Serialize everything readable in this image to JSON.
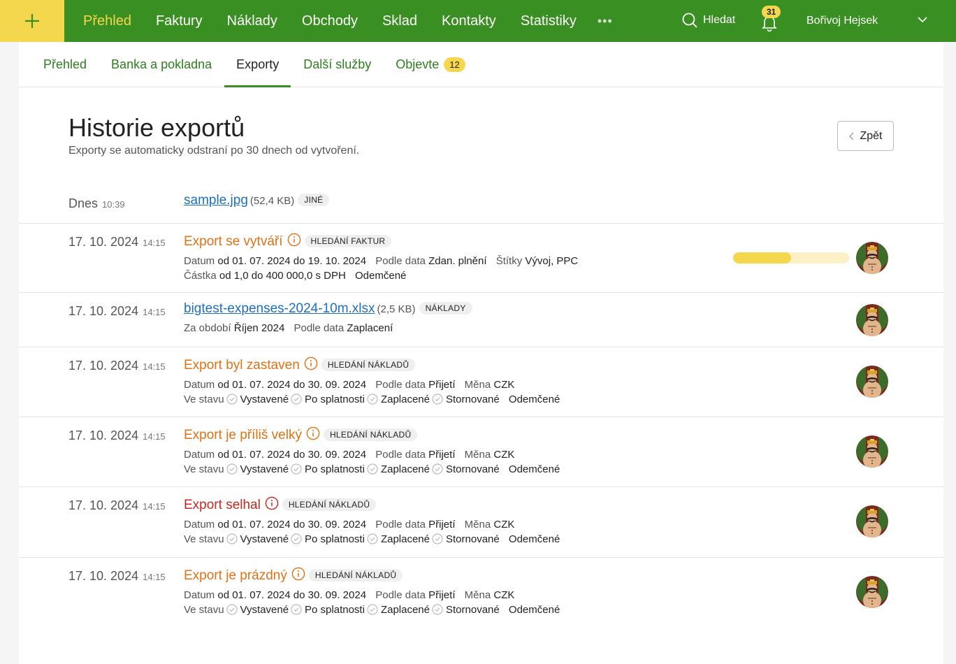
{
  "topnav": {
    "plus_label": "+",
    "items": [
      {
        "label": "Přehled",
        "active": true
      },
      {
        "label": "Faktury"
      },
      {
        "label": "Náklady"
      },
      {
        "label": "Obchody"
      },
      {
        "label": "Sklad"
      },
      {
        "label": "Kontakty"
      },
      {
        "label": "Statistiky"
      }
    ],
    "more_label": "•••",
    "search_label": "Hledat",
    "notifications_count": "31",
    "user_name": "Bořivoj Hejsek"
  },
  "subnav": {
    "tabs": [
      {
        "label": "Přehled"
      },
      {
        "label": "Banka a pokladna"
      },
      {
        "label": "Exporty",
        "active": true
      },
      {
        "label": "Další služby"
      },
      {
        "label": "Objevte",
        "badge": "12"
      }
    ]
  },
  "page": {
    "title": "Historie exportů",
    "subtitle": "Exporty se automaticky odstraní po 30 dnech od vytvoření.",
    "back_label": "Zpět"
  },
  "labels": {
    "datum": "Datum",
    "podle_data": "Podle data",
    "stitky": "Štítky",
    "castka": "Částka",
    "za_obdobi": "Za období",
    "mena": "Měna",
    "ve_stavu": "Ve stavu",
    "vystavene": "Vystavené",
    "po_splatnosti": "Po splatnosti",
    "zaplacene": "Zaplacené",
    "stornovane": "Stornované",
    "odemcene": "Odemčené"
  },
  "exports": [
    {
      "date": "Dnes",
      "time": "10:39",
      "title": "sample.jpg",
      "size": "(52,4 KB)",
      "tag": "JINÉ"
    },
    {
      "date": "17. 10. 2024",
      "time": "14:15",
      "title": "Export se vytváří",
      "tag": "HLEDÁNÍ FAKTUR",
      "datum_value": "od 01. 07. 2024 do 19. 10. 2024",
      "podle_data_value": "Zdan. plnění",
      "stitky_value": "Vývoj, PPC",
      "castka_value": "od 1,0 do 400 000,0 s DPH",
      "progress": 0.5
    },
    {
      "date": "17. 10. 2024",
      "time": "14:15",
      "title": "bigtest-expenses-2024-10m.xlsx",
      "size": "(2,5 KB)",
      "tag": "NÁKLADY",
      "obdobi_value": "Říjen 2024",
      "podle_data_value": "Zaplacení"
    },
    {
      "date": "17. 10. 2024",
      "time": "14:15",
      "title": "Export byl zastaven",
      "tag": "HLEDÁNÍ NÁKLADŮ",
      "datum_value": "od 01. 07. 2024 do 30. 09. 2024",
      "podle_data_value": "Přijetí",
      "mena_value": "CZK"
    },
    {
      "date": "17. 10. 2024",
      "time": "14:15",
      "title": "Export je příliš velký",
      "tag": "HLEDÁNÍ NÁKLADŮ",
      "datum_value": "od 01. 07. 2024 do 30. 09. 2024",
      "podle_data_value": "Přijetí",
      "mena_value": "CZK"
    },
    {
      "date": "17. 10. 2024",
      "time": "14:15",
      "title": "Export selhal",
      "tag": "HLEDÁNÍ NÁKLADŮ",
      "datum_value": "od 01. 07. 2024 do 30. 09. 2024",
      "podle_data_value": "Přijetí",
      "mena_value": "CZK"
    },
    {
      "date": "17. 10. 2024",
      "time": "14:15",
      "title": "Export je prázdný",
      "tag": "HLEDÁNÍ NÁKLADŮ",
      "datum_value": "od 01. 07. 2024 do 30. 09. 2024",
      "podle_data_value": "Přijetí",
      "mena_value": "CZK"
    }
  ],
  "colors": {
    "brand_green": "#3a8f22",
    "accent_yellow": "#f5d74e",
    "link_blue": "#1f6fc0",
    "warning_orange": "#e07214",
    "error_red": "#c6281f"
  },
  "icons": [
    "plus-icon",
    "search-icon",
    "bell-icon",
    "chevron-down-icon",
    "chevron-left-icon",
    "info-icon",
    "check-circle-icon",
    "avatar"
  ]
}
